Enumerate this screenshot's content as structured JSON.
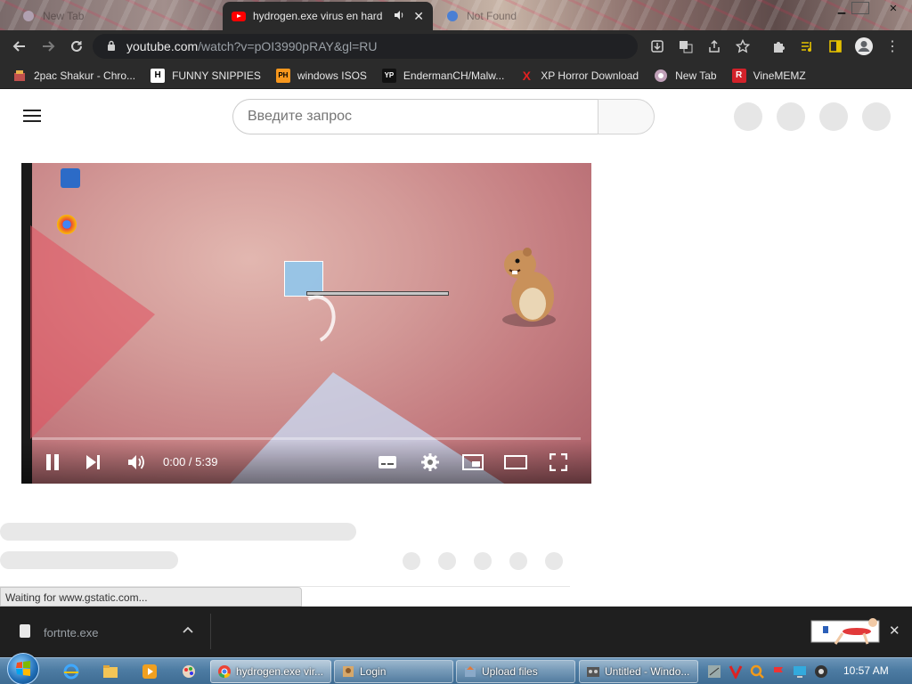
{
  "browser": {
    "tabs": [
      {
        "title": "New Tab",
        "active": false
      },
      {
        "title": "hydrogen.exe virus en hard",
        "active": true,
        "muted_icon": "speaker-icon"
      },
      {
        "title": "Not Found",
        "active": false
      }
    ],
    "url_host": "youtube.com",
    "url_path": "/watch?v=pOI3990pRAY&gl=RU",
    "bookmarks": [
      {
        "label": "2pac Shakur - Chro...",
        "icon": "bm-2pac-icon"
      },
      {
        "label": "FUNNY SNIPPIES",
        "icon": "H"
      },
      {
        "label": "windows ISOS",
        "icon": "PH"
      },
      {
        "label": "EndermanCH/Malw...",
        "icon": "YP"
      },
      {
        "label": "XP Horror Download",
        "icon": "X"
      },
      {
        "label": "New Tab",
        "icon": "globe-icon"
      },
      {
        "label": "VineMEMZ",
        "icon": "R"
      }
    ]
  },
  "youtube": {
    "search_placeholder": "Введите запрос",
    "player": {
      "time": "0:00 / 5:39",
      "progress": 0.0,
      "state": "playing"
    }
  },
  "status_bar": "Waiting for www.gstatic.com...",
  "download_shelf": {
    "file_name": "fortnte.exe"
  },
  "taskbar": {
    "tasks": [
      {
        "label": "hydrogen.exe vir...",
        "icon": "chrome-icon"
      },
      {
        "label": "Login",
        "icon": "login-icon"
      },
      {
        "label": "Upload files",
        "icon": "upload-icon"
      },
      {
        "label": "Untitled - Windo...",
        "icon": "movie-maker-icon"
      }
    ],
    "clock": "10:57 AM"
  },
  "colors": {
    "chrome_dark": "#2b2b2b",
    "youtube_red": "#ff0000",
    "taskbar_blue": "#4d7ca3"
  }
}
